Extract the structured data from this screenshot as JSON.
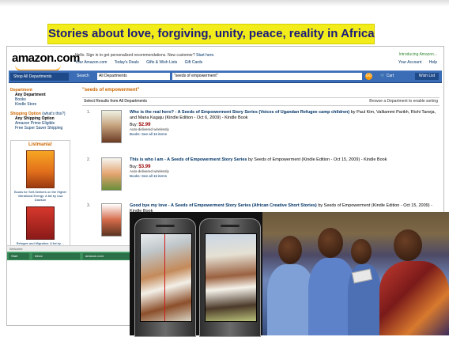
{
  "banner": "Stories about love, forgiving, unity, peace, reality in Africa",
  "amazon": {
    "logo": "amazon.com",
    "hello_text": "Hello. Sign in to get personalized recommendations. New customer?",
    "start_here": "Start here.",
    "green_link": "Introducing Amazon...",
    "top_links": [
      "Your Amazon.com",
      "Today's Deals",
      "Gifts & Wish Lists",
      "Gift Cards"
    ],
    "right_links": [
      "Your Account",
      "Help"
    ],
    "shop_button": "Shop All Departments",
    "search_label": "Search",
    "department": "All Departments",
    "search_value": "\"seeds of empowerment\"",
    "go_label": "GO",
    "cart_label": "Cart",
    "wishlist_label": "Wish List"
  },
  "sidebar": {
    "department_heading": "Department",
    "department_items": [
      "Any Department",
      "Books",
      "Kindle Store"
    ],
    "shipping_heading": "Shipping Option",
    "shipping_link": "(what's this?)",
    "shipping_items": [
      "Any Shipping Option",
      "Amazon Prime Eligible",
      "Free Super Saver Shipping"
    ],
    "box_title": "Listmania!",
    "box1_caption": "Books for Self-Seekers on the Higher Vibrational Energy: A list by Lisa Dawson",
    "box2_caption": "Refugee and Migration: A list by ..."
  },
  "results": {
    "query_title": "\"seeds of empowerment\"",
    "count_text": "Select Results from All Departments",
    "sort_text": "Browse a Department to enable sorting",
    "items": [
      {
        "num": "1.",
        "title": "Who is the real hero? - A Seeds of Empowerment Story Series (Voices of Ugandan Refugee camp children)",
        "by": "by Paul Kim, Valliammi Parikh, Rishi Taneja, and Maria Kagaju (Kindle Edition - Oct 6, 2009) - Kindle Book",
        "buy": "Buy: ",
        "price": "$2.99",
        "delivery": "Auto-delivered wirelessly",
        "more": "Books: See all 16 items"
      },
      {
        "num": "2.",
        "title": "This is who I am - A Seeds of Empowerment Story Series",
        "by": "by Seeds of Empowerment (Kindle Edition - Oct 15, 2009) - Kindle Book",
        "buy": "Buy: ",
        "price": "$3.99",
        "delivery": "Auto-delivered wirelessly",
        "more": "Books: See all 16 items"
      },
      {
        "num": "3.",
        "title": "Good bye my love - A Seeds of Empowerment Story Series (African Creative Short Stories)",
        "by": "by Seeds of Empowerment (Kindle Edition - Oct 15, 2009) - Kindle Book",
        "buy": "",
        "price": "",
        "delivery": "",
        "more": ""
      }
    ]
  },
  "strip_text": "Welcome",
  "taskbar": [
    "Start",
    "Inbox",
    "amazon.com",
    "Document"
  ]
}
